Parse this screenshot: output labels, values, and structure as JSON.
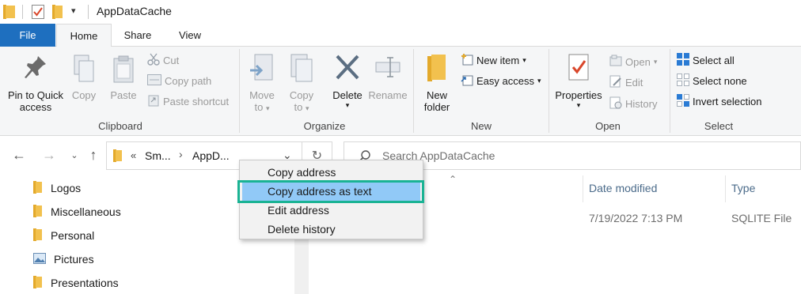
{
  "window": {
    "title": "AppDataCache"
  },
  "tabs": [
    {
      "label": "File"
    },
    {
      "label": "Home"
    },
    {
      "label": "Share"
    },
    {
      "label": "View"
    }
  ],
  "ribbon": {
    "clipboard": {
      "group_label": "Clipboard",
      "pin_label_1": "Pin to Quick",
      "pin_label_2": "access",
      "copy_label": "Copy",
      "paste_label": "Paste",
      "cut_label": "Cut",
      "copy_path_label": "Copy path",
      "paste_shortcut_label": "Paste shortcut"
    },
    "organize": {
      "group_label": "Organize",
      "move_to_1": "Move",
      "move_to_2": "to",
      "copy_to_1": "Copy",
      "copy_to_2": "to",
      "delete_label": "Delete",
      "rename_label": "Rename"
    },
    "new": {
      "group_label": "New",
      "new_folder_1": "New",
      "new_folder_2": "folder",
      "new_item_label": "New item",
      "easy_access_label": "Easy access"
    },
    "open": {
      "group_label": "Open",
      "properties_label": "Properties",
      "open_label": "Open",
      "edit_label": "Edit",
      "history_label": "History"
    },
    "select": {
      "group_label": "Select",
      "select_all_label": "Select all",
      "select_none_label": "Select none",
      "invert_selection_label": "Invert selection"
    }
  },
  "address": {
    "overflow": "«",
    "crumb_1": "Sm...",
    "crumb_2": "AppD...",
    "search_placeholder": "Search AppDataCache"
  },
  "navpane": {
    "items": [
      {
        "label": "Logos"
      },
      {
        "label": "Miscellaneous"
      },
      {
        "label": "Personal"
      },
      {
        "label": "Pictures"
      },
      {
        "label": "Presentations"
      }
    ]
  },
  "filelist": {
    "columns": {
      "date_modified": "Date modified",
      "type": "Type"
    },
    "rows": [
      {
        "date_modified": "7/19/2022 7:13 PM",
        "type": "SQLITE File"
      }
    ]
  },
  "context_menu": {
    "items": [
      {
        "label": "Copy address"
      },
      {
        "label": "Copy address as text"
      },
      {
        "label": "Edit address"
      },
      {
        "label": "Delete history"
      }
    ]
  },
  "colors": {
    "file_tab": "#1e6fbf",
    "highlight_item": "#91c9f7",
    "annotation_outline": "#1ab394",
    "folder": "#f2c14e"
  }
}
